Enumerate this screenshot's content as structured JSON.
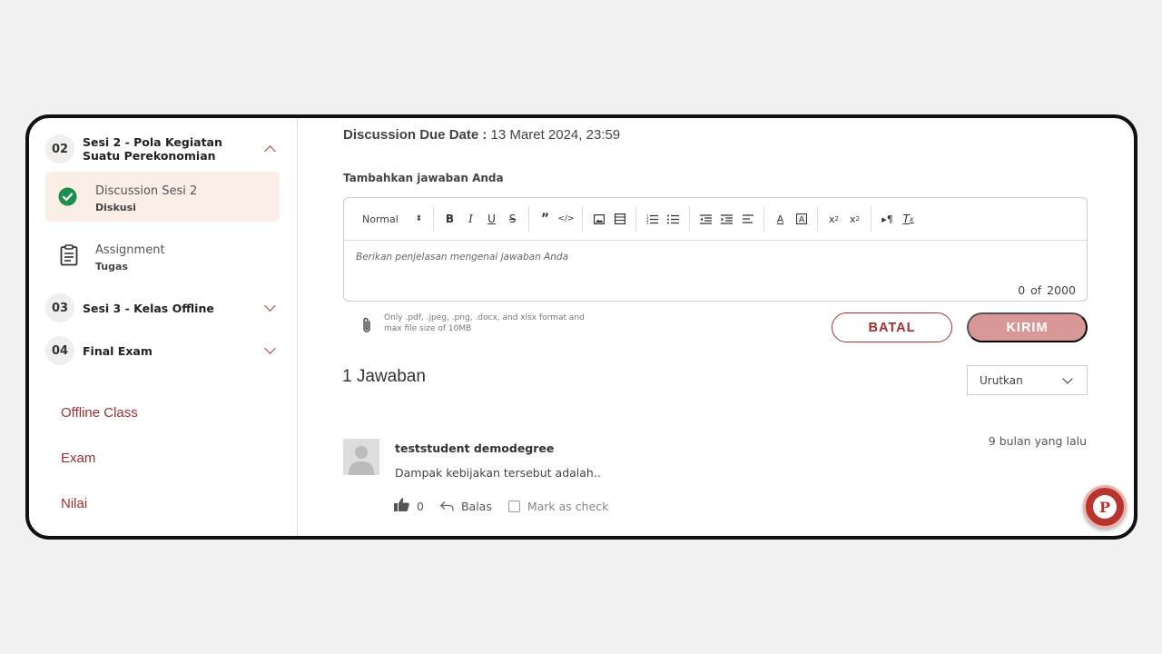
{
  "sidebar": {
    "sessions": [
      {
        "num": "02",
        "title": "Sesi 2 - Pola Kegiatan Suatu Perekonomian",
        "expanded": true
      },
      {
        "num": "03",
        "title": "Sesi 3 - Kelas Offline",
        "expanded": false
      },
      {
        "num": "04",
        "title": "Final Exam",
        "expanded": false
      }
    ],
    "lessons": [
      {
        "title": "Discussion Sesi 2",
        "type": "Diskusi",
        "icon": "check-circle-icon",
        "active": true
      },
      {
        "title": "Assignment",
        "type": "Tugas",
        "icon": "clipboard-icon",
        "active": false
      }
    ],
    "links": [
      "Offline Class",
      "Exam",
      "Nilai"
    ]
  },
  "main": {
    "due_label": "Discussion Due Date :",
    "due_value": "13 Maret 2024, 23:59",
    "add_label": "Tambahkan jawaban Anda",
    "editor": {
      "format_select": "Normal",
      "placeholder": "Berikan penjelasan mengenai jawaban Anda",
      "counter": "0  of  2000"
    },
    "attach_note": "Only .pdf, .jpeg, .png, .docx, and xlsx format and max file size of 10MB",
    "batal_label": "BATAL",
    "kirim_label": "KIRIM",
    "answers_title": "1 Jawaban",
    "sort_label": "Urutkan",
    "answer": {
      "author": "teststudent demodegree",
      "time": "9 bulan yang lalu",
      "text": "Dampak kebijakan tersebut adalah..",
      "likes": "0",
      "reply_label": "Balas",
      "mark_label": "Mark as check"
    }
  },
  "colors": {
    "accent": "#a0302f",
    "kirim_disabled": "#d89898",
    "active_bg": "#fbeee6",
    "success": "#1e8e4e"
  }
}
